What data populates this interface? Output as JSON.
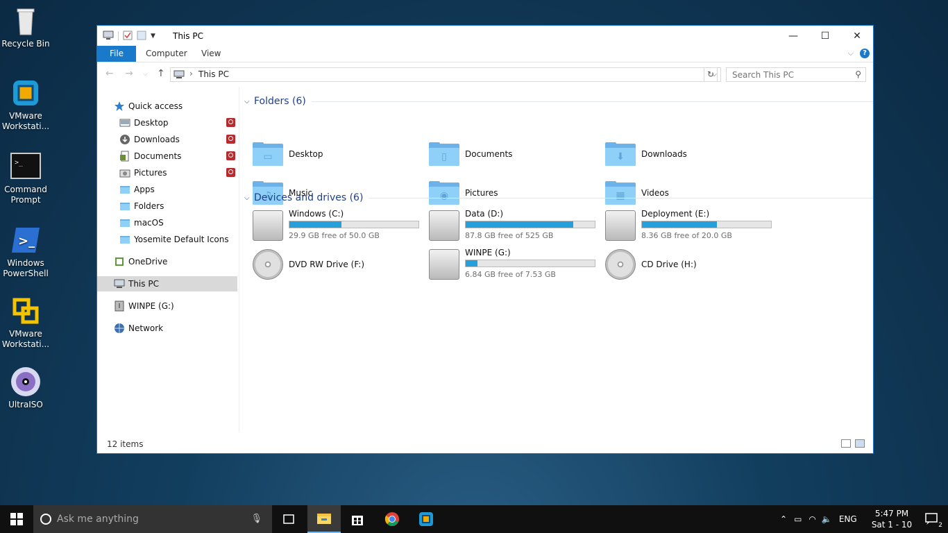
{
  "desktop": {
    "icons": [
      {
        "label1": "Recycle Bin",
        "label2": ""
      },
      {
        "label1": "VMware",
        "label2": "Workstati..."
      },
      {
        "label1": "Command",
        "label2": "Prompt"
      },
      {
        "label1": "Windows",
        "label2": "PowerShell"
      },
      {
        "label1": "VMware",
        "label2": "Workstati..."
      },
      {
        "label1": "UltraISO",
        "label2": ""
      }
    ]
  },
  "window": {
    "title": "This PC",
    "tabs": {
      "file": "File",
      "computer": "Computer",
      "view": "View"
    },
    "help": "?"
  },
  "address": {
    "crumb": "This PC",
    "search_placeholder": "Search This PC"
  },
  "nav": {
    "quick_access": "Quick access",
    "quick_items": [
      "Desktop",
      "Downloads",
      "Documents",
      "Pictures",
      "Apps",
      "Folders",
      "macOS",
      "Yosemite Default Icons"
    ],
    "onedrive": "OneDrive",
    "this_pc": "This PC",
    "winpe": "WINPE (G:)",
    "network": "Network"
  },
  "folders": {
    "header": "Folders (6)",
    "items": [
      "Desktop",
      "Documents",
      "Downloads",
      "Music",
      "Pictures",
      "Videos"
    ]
  },
  "devices": {
    "header": "Devices and drives (6)",
    "items": [
      {
        "name": "Windows (C:)",
        "free": "29.9 GB free of 50.0 GB",
        "used_fraction": 0.402
      },
      {
        "name": "Data (D:)",
        "free": "87.8 GB free of 525 GB",
        "used_fraction": 0.833
      },
      {
        "name": "Deployment (E:)",
        "free": "8.36 GB free of 20.0 GB",
        "used_fraction": 0.582
      },
      {
        "name": "DVD RW Drive (F:)",
        "free": "",
        "used_fraction": null
      },
      {
        "name": "WINPE (G:)",
        "free": "6.84 GB free of 7.53 GB",
        "used_fraction": 0.092
      },
      {
        "name": "CD Drive (H:)",
        "free": "",
        "used_fraction": null
      }
    ]
  },
  "status": {
    "count": "12 items"
  },
  "taskbar": {
    "search_placeholder": "Ask me anything",
    "lang": "ENG",
    "time": "5:47 PM",
    "date": "Sat 1 - 10",
    "notifications": "2"
  },
  "colors": {
    "accent": "#1979ca",
    "drive_bar": "#26a0da",
    "folder": "#8ed0f7",
    "selection": "#d9d9d9"
  }
}
